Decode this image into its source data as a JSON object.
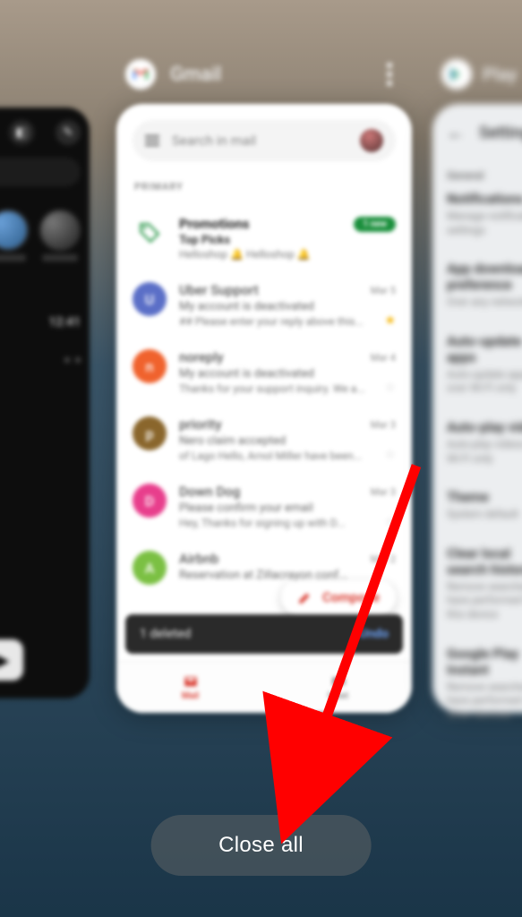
{
  "close_all_label": "Close all",
  "center": {
    "app_title": "Gmail",
    "search_placeholder": "Search in mail",
    "section_label": "PRIMARY",
    "promo": {
      "title": "Promotions",
      "badge": "1 new",
      "subject": "Top Picks",
      "snippet_a": "Helloshop",
      "snippet_b": "Helloshop"
    },
    "mails": [
      {
        "sender": "Uber Support",
        "date": "Mar 5",
        "subject": "My account is deactivated",
        "snippet": "## Please enter your reply above this...",
        "starred": true,
        "color": "#5b6fc7"
      },
      {
        "sender": "noreply",
        "date": "Mar 4",
        "subject": "My account is deactivated",
        "snippet": "Thanks for your support inquiry. We a...",
        "starred": false,
        "color": "#f0622d"
      },
      {
        "sender": "priority",
        "date": "Mar 3",
        "subject": "Nero claim accepted",
        "snippet": "of Lago Hello, Arnol Miller have been...",
        "starred": false,
        "color": "#8a662c"
      },
      {
        "sender": "Down Dog",
        "date": "Mar 3",
        "subject": "Please confirm your email",
        "snippet": "Hey, Thanks for signing up with D...",
        "starred": false,
        "color": "#e83e8c"
      },
      {
        "sender": "Airbnb",
        "date": "Mar 2",
        "subject": "Reservation at Zillacrayon conf...",
        "snippet": "",
        "starred": false,
        "color": "#7bc043"
      }
    ],
    "compose_label": "Compose",
    "snackbar_text": "1 deleted",
    "snackbar_action": "Undo",
    "nav_mail": "Mail",
    "nav_meet": "Meet"
  },
  "right": {
    "app_title": "Play",
    "header": "Settings",
    "section": "General",
    "rows": [
      {
        "title": "Notifications",
        "sub": "Manage notification settings"
      },
      {
        "title": "App download preference",
        "sub": "Over any network"
      },
      {
        "title": "Auto-update apps",
        "sub": "Auto-update apps over Wi-Fi only"
      },
      {
        "title": "Auto-play videos",
        "sub": "Auto-play videos over Wi-Fi only"
      },
      {
        "title": "Theme",
        "sub": "System default"
      },
      {
        "title": "Clear local search history",
        "sub": "Remove searches you have performed from this device"
      },
      {
        "title": "Google Play Instant",
        "sub": "Remove searches you have performed with other devices"
      }
    ]
  },
  "left": {
    "time": "12:41"
  }
}
